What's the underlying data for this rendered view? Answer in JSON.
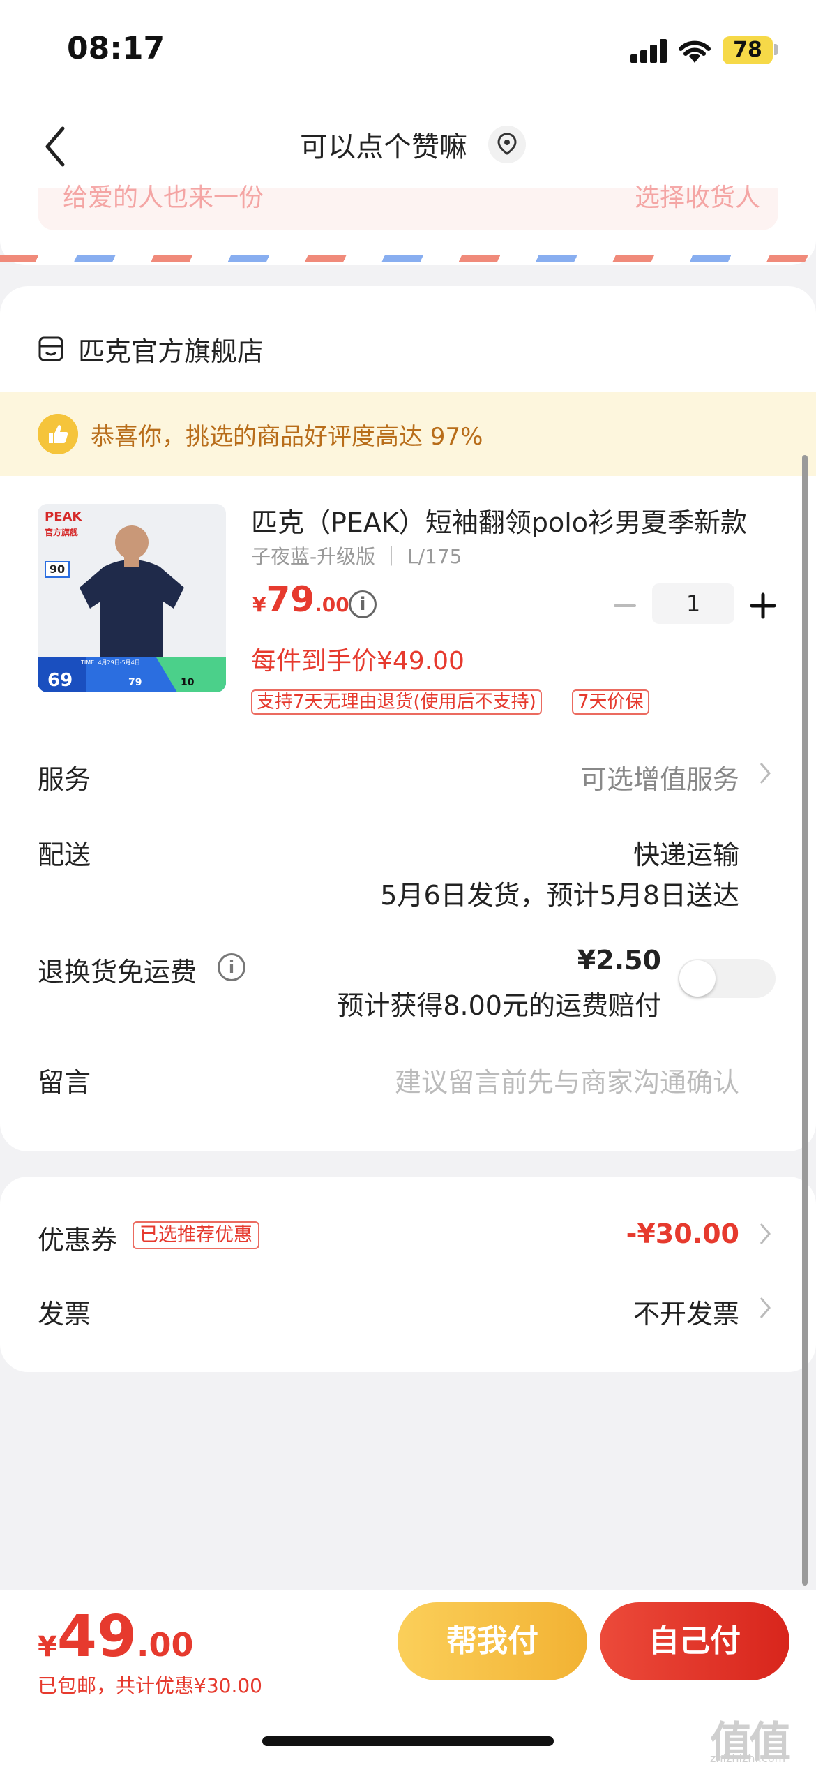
{
  "status_bar": {
    "time": "08:17",
    "battery": "78"
  },
  "nav": {
    "title": "可以点个赞嘛"
  },
  "address": {
    "hint": "给爱的人也来一份",
    "choose_label": "选择收货人"
  },
  "store": {
    "name": "匹克官方旗舰店"
  },
  "praise": {
    "text": "恭喜你，挑选的商品好评度高达 97%"
  },
  "product": {
    "title": "匹克（PEAK）短袖翻领polo衫男夏季新款",
    "spec": "子夜蓝-升级版 ｜ L/175",
    "price_symbol": "¥",
    "price_int": "79",
    "price_dec": ".00",
    "quantity": "1",
    "per_item_price": "每件到手价¥49.00",
    "tags": [
      "支持7天无理由退货(使用后不支持)",
      "7天价保"
    ],
    "image_text": {
      "brand": "PEAK",
      "store": "官方旗舰",
      "badge": "90",
      "price": "69",
      "time": "TIME: 4月29日-5月4日",
      "coupon1": "79",
      "coupon2": "10"
    }
  },
  "rows": {
    "service_label": "服务",
    "service_value": "可选增值服务",
    "delivery_label": "配送",
    "delivery_method": "快递运输",
    "delivery_date": "5月6日发货，预计5月8日送达",
    "return_label": "退换货免运费",
    "return_price": "¥2.50",
    "return_desc": "预计获得8.00元的运费赔付",
    "message_label": "留言",
    "message_placeholder": "建议留言前先与商家沟通确认"
  },
  "coupon": {
    "label": "优惠券",
    "tag": "已选推荐优惠",
    "value": "-¥30.00",
    "invoice_label": "发票",
    "invoice_value": "不开发票"
  },
  "bottom": {
    "total_symbol": "¥",
    "total_int": "49",
    "total_dec": ".00",
    "total_sub": "已包邮，共计优惠¥30.00",
    "help_pay": "帮我付",
    "self_pay": "自己付"
  },
  "watermark": {
    "text": "值值值",
    "url": "zhizhizhi.com"
  },
  "colors": {
    "accent_red": "#e63a2e",
    "gold": "#f2b233",
    "praise_bg": "#fdf6dd"
  }
}
